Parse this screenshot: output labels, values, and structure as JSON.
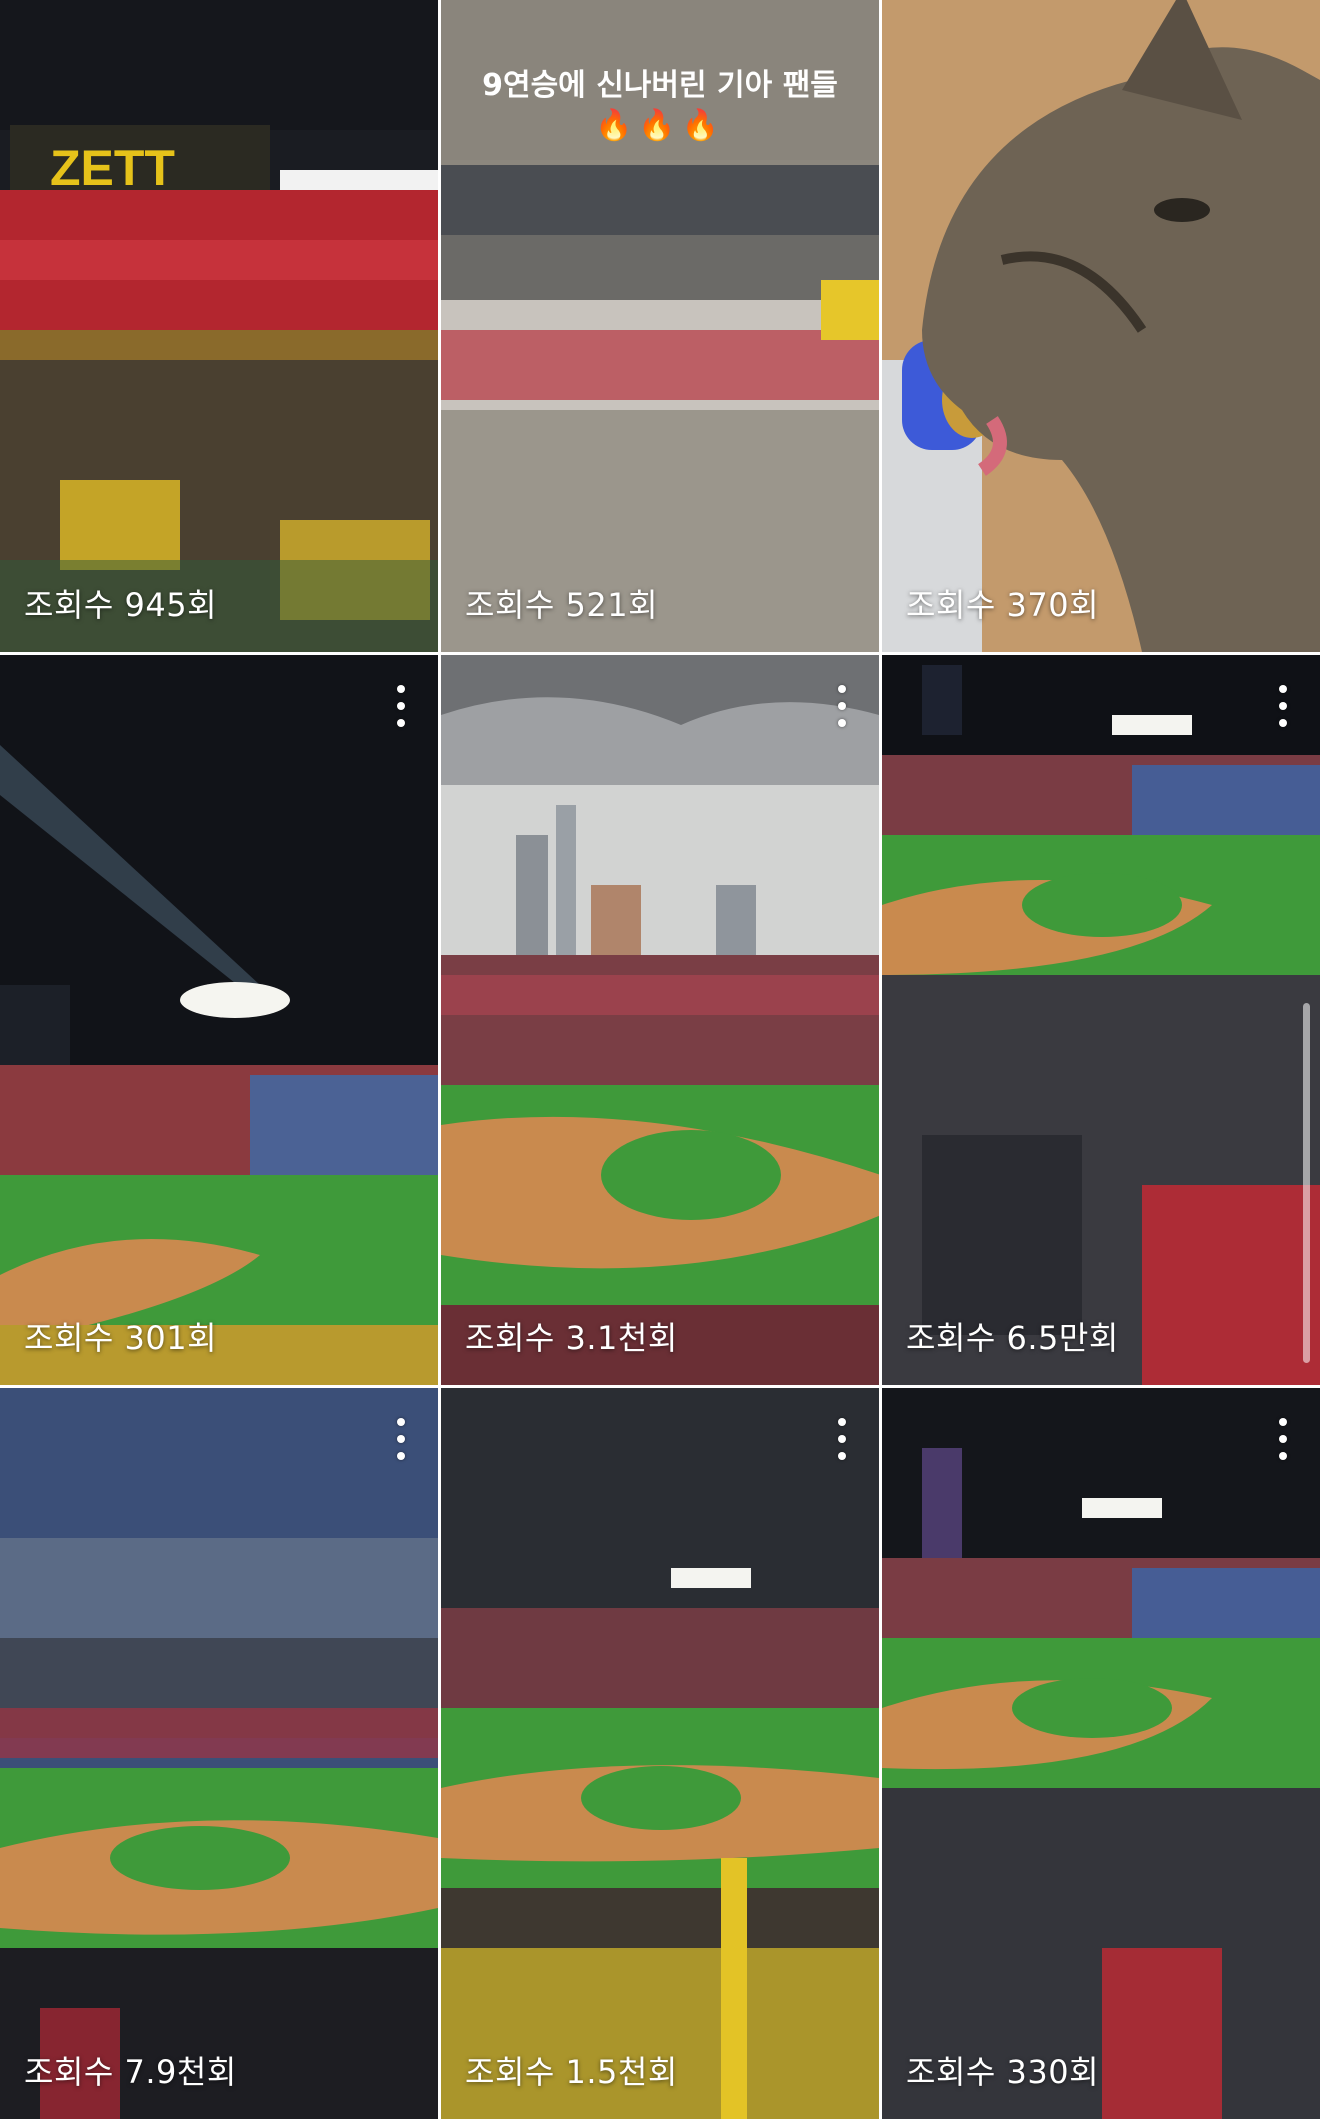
{
  "grid": {
    "items": [
      {
        "views": "조회수 945회",
        "has_menu": false,
        "thumbnail": "stadium-crowd-night"
      },
      {
        "views": "조회수 521회",
        "has_menu": false,
        "thumbnail": "story-concourse",
        "caption": "9연승에 신나버린 기아 팬들",
        "emoji": "🔥🔥🔥"
      },
      {
        "views": "조회수 370회",
        "has_menu": false,
        "thumbnail": "cat-closeup"
      },
      {
        "views": "조회수 301회",
        "has_menu": true,
        "thumbnail": "baseball-field-night"
      },
      {
        "views": "조회수 3.1천회",
        "has_menu": true,
        "thumbnail": "baseball-field-cloudy"
      },
      {
        "views": "조회수 6.5만회",
        "has_menu": true,
        "thumbnail": "baseball-field-crowd"
      },
      {
        "views": "조회수 7.9천회",
        "has_menu": true,
        "thumbnail": "baseball-field-dusk"
      },
      {
        "views": "조회수 1.5천회",
        "has_menu": true,
        "thumbnail": "baseball-field-yellow-fans"
      },
      {
        "views": "조회수 330회",
        "has_menu": true,
        "thumbnail": "baseball-field-night-crowd"
      }
    ]
  },
  "icons": {
    "more": "more-vertical-icon"
  },
  "colors": {
    "field_green": "#3f9a3a",
    "dirt": "#c98a4e",
    "crowd_red": "#c22a35",
    "crowd_yellow": "#e3c326",
    "sky_night": "#121418",
    "story_bg": "#8a857c"
  }
}
